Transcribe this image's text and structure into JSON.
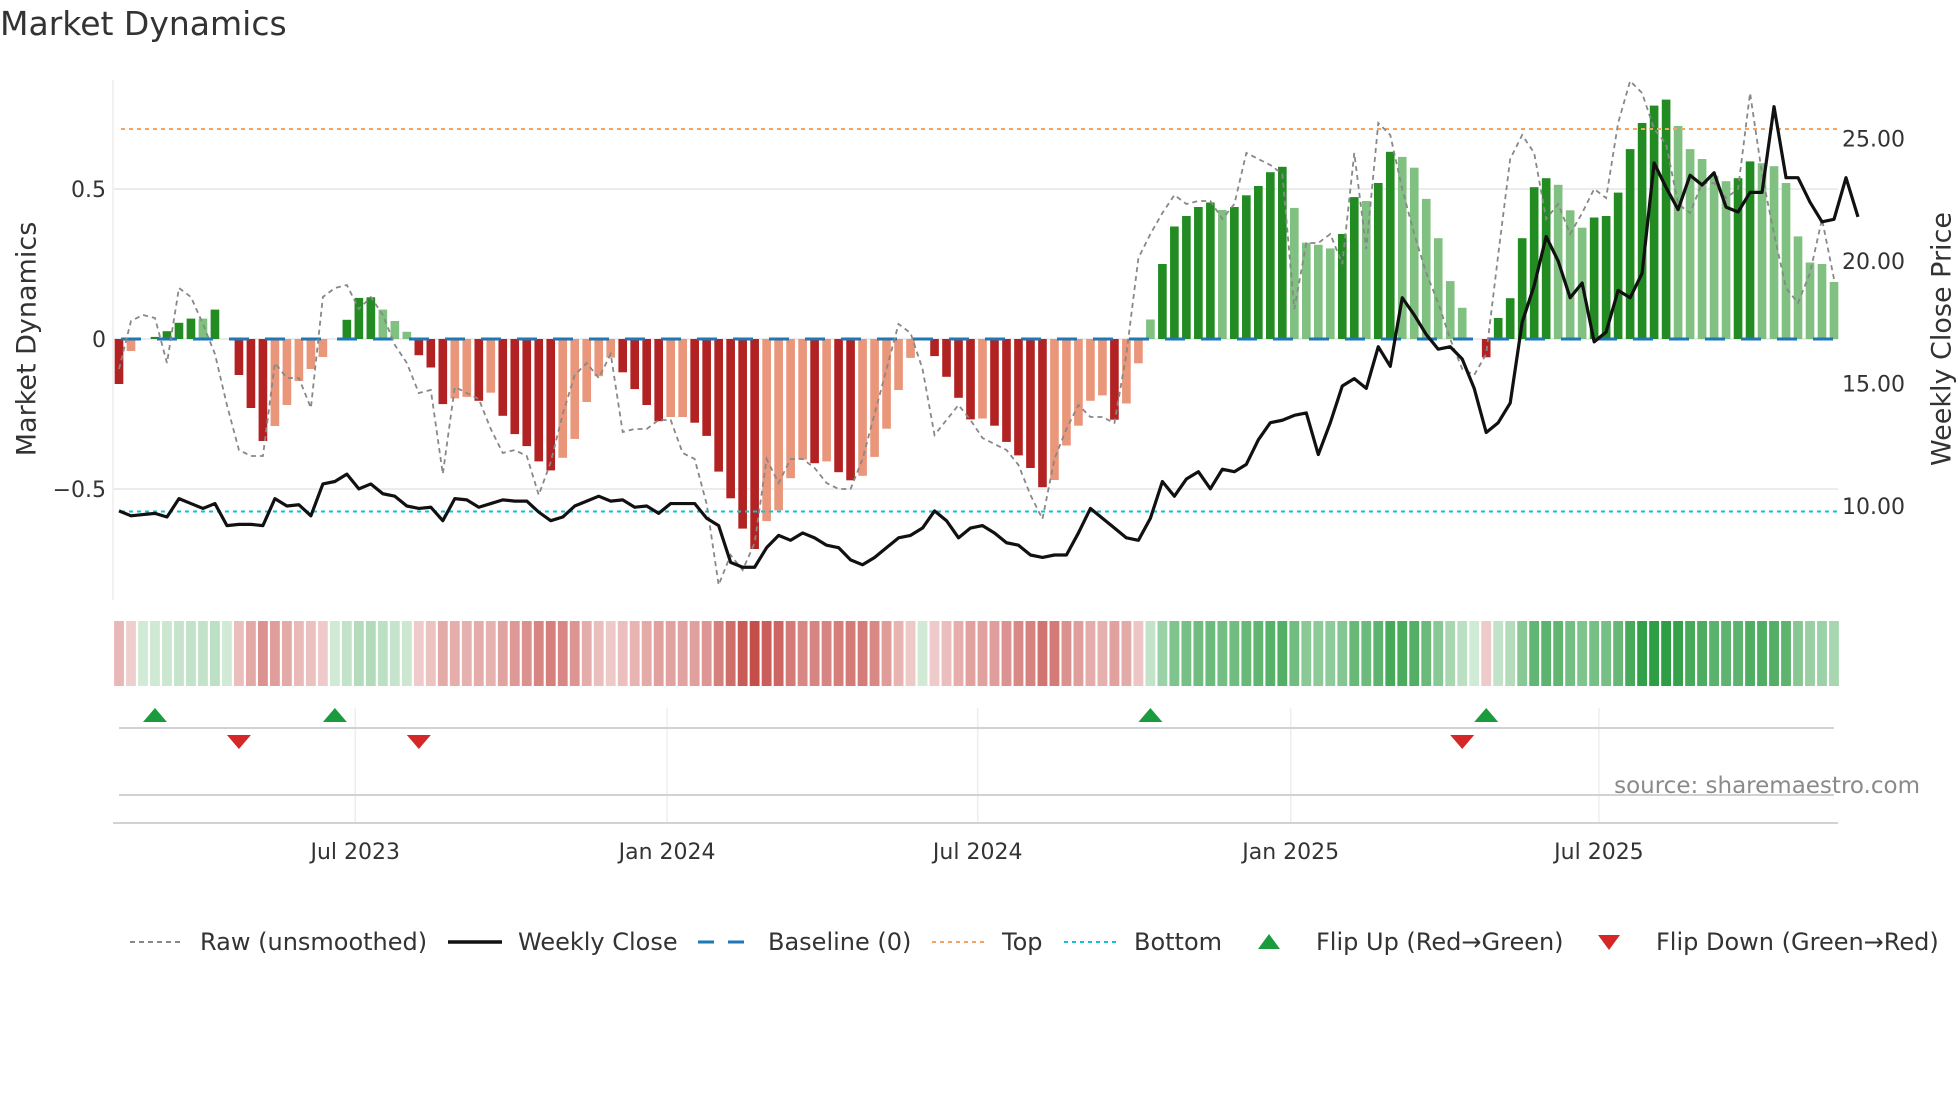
{
  "chart_data": {
    "type": "bar",
    "title": "Market Dynamics",
    "ylabel": "Market Dynamics",
    "y2label": "Weekly Close Price",
    "ylim": [
      -0.88,
      0.86
    ],
    "y2lim": [
      5.9,
      27.7
    ],
    "yticks": [
      {
        "v": 0.5,
        "label": "0.5"
      },
      {
        "v": 0,
        "label": "0"
      },
      {
        "v": -0.5,
        "label": "−0.5"
      }
    ],
    "y2ticks": [
      {
        "v": 25,
        "label": "25.00"
      },
      {
        "v": 20,
        "label": "20.00"
      },
      {
        "v": 15,
        "label": "15.00"
      },
      {
        "v": 10,
        "label": "10.00"
      }
    ],
    "xticks": [
      {
        "idx": 19.7,
        "label": "Jul 2023"
      },
      {
        "idx": 45.7,
        "label": "Jan 2024"
      },
      {
        "idx": 71.6,
        "label": "Jul 2024"
      },
      {
        "idx": 97.7,
        "label": "Jan 2025"
      },
      {
        "idx": 123.4,
        "label": "Jul 2025"
      }
    ],
    "top_level": 0.7,
    "bottom_level": -0.575,
    "baseline": 0,
    "colors": {
      "up_strong": "#228b22",
      "up_weak": "#80c080",
      "down_strong": "#b22222",
      "down_weak": "#e9967a",
      "top": "#f4a460",
      "bottom": "#17becf",
      "baseline": "#1f77b4",
      "raw": "#888888",
      "close": "#111111",
      "flip_up": "#1a9c3e",
      "flip_down": "#d62728"
    },
    "values": [
      -0.15,
      -0.04,
      0,
      0.007,
      0.026,
      0.054,
      0.068,
      0.068,
      0.098,
      0,
      -0.12,
      -0.23,
      -0.34,
      -0.29,
      -0.22,
      -0.14,
      -0.1,
      -0.06,
      0,
      0.064,
      0.137,
      0.139,
      0.098,
      0.06,
      0.024,
      -0.054,
      -0.095,
      -0.217,
      -0.198,
      -0.193,
      -0.206,
      -0.179,
      -0.256,
      -0.317,
      -0.357,
      -0.408,
      -0.438,
      -0.396,
      -0.333,
      -0.21,
      -0.124,
      -0.062,
      -0.111,
      -0.167,
      -0.22,
      -0.274,
      -0.26,
      -0.26,
      -0.279,
      -0.323,
      -0.442,
      -0.531,
      -0.632,
      -0.7,
      -0.607,
      -0.571,
      -0.464,
      -0.402,
      -0.414,
      -0.408,
      -0.444,
      -0.471,
      -0.456,
      -0.393,
      -0.299,
      -0.17,
      -0.063,
      0,
      -0.057,
      -0.126,
      -0.196,
      -0.268,
      -0.265,
      -0.289,
      -0.343,
      -0.388,
      -0.43,
      -0.494,
      -0.47,
      -0.355,
      -0.289,
      -0.206,
      -0.188,
      -0.269,
      -0.215,
      -0.081,
      0.065,
      0.25,
      0.375,
      0.41,
      0.44,
      0.455,
      0.43,
      0.44,
      0.479,
      0.51,
      0.556,
      0.574,
      0.437,
      0.321,
      0.314,
      0.302,
      0.35,
      0.473,
      0.46,
      0.52,
      0.624,
      0.607,
      0.571,
      0.467,
      0.336,
      0.193,
      0.104,
      0,
      -0.061,
      0.07,
      0.136,
      0.336,
      0.506,
      0.536,
      0.514,
      0.429,
      0.371,
      0.405,
      0.41,
      0.488,
      0.633,
      0.72,
      0.778,
      0.798,
      0.71,
      0.633,
      0.6,
      0.544,
      0.526,
      0.536,
      0.592,
      0.586,
      0.576,
      0.52,
      0.342,
      0.255,
      0.25,
      0.19
    ],
    "raw": [
      -0.1,
      0.06,
      0.08,
      0.07,
      -0.08,
      0.17,
      0.14,
      0.05,
      -0.05,
      -0.22,
      -0.37,
      -0.39,
      -0.39,
      -0.08,
      -0.13,
      -0.13,
      -0.23,
      0.14,
      0.17,
      0.18,
      0.1,
      0.14,
      0.08,
      -0.02,
      -0.08,
      -0.18,
      -0.17,
      -0.45,
      -0.16,
      -0.18,
      -0.2,
      -0.3,
      -0.38,
      -0.37,
      -0.39,
      -0.52,
      -0.41,
      -0.25,
      -0.12,
      -0.08,
      -0.13,
      -0.05,
      -0.31,
      -0.3,
      -0.3,
      -0.27,
      -0.27,
      -0.38,
      -0.4,
      -0.55,
      -0.82,
      -0.72,
      -0.77,
      -0.68,
      -0.4,
      -0.48,
      -0.4,
      -0.4,
      -0.43,
      -0.48,
      -0.5,
      -0.5,
      -0.4,
      -0.25,
      -0.1,
      0.05,
      0.02,
      -0.1,
      -0.32,
      -0.27,
      -0.22,
      -0.27,
      -0.33,
      -0.35,
      -0.37,
      -0.42,
      -0.52,
      -0.6,
      -0.4,
      -0.3,
      -0.22,
      -0.26,
      -0.26,
      -0.28,
      -0.05,
      0.27,
      0.35,
      0.42,
      0.48,
      0.45,
      0.46,
      0.46,
      0.4,
      0.45,
      0.62,
      0.6,
      0.58,
      0.55,
      0.1,
      0.32,
      0.32,
      0.35,
      0.25,
      0.62,
      0.3,
      0.72,
      0.68,
      0.5,
      0.35,
      0.22,
      0.12,
      0.0,
      -0.1,
      -0.12,
      -0.05,
      0.28,
      0.6,
      0.68,
      0.62,
      0.4,
      0.45,
      0.35,
      0.42,
      0.5,
      0.47,
      0.72,
      0.86,
      0.82,
      0.7,
      0.65,
      0.45,
      0.42,
      0.52,
      0.52,
      0.47,
      0.5,
      0.82,
      0.55,
      0.35,
      0.17,
      0.12,
      0.22,
      0.4,
      0.2
    ],
    "close": [
      9.8,
      9.6,
      9.65,
      9.7,
      9.55,
      10.3,
      10.1,
      9.9,
      10.1,
      9.2,
      9.25,
      9.25,
      9.2,
      10.3,
      10.0,
      10.05,
      9.6,
      10.9,
      11.0,
      11.3,
      10.7,
      10.9,
      10.5,
      10.4,
      10.0,
      9.9,
      9.95,
      9.4,
      10.3,
      10.25,
      9.95,
      10.1,
      10.25,
      10.2,
      10.2,
      9.75,
      9.4,
      9.55,
      10.0,
      10.2,
      10.4,
      10.2,
      10.25,
      9.95,
      10.0,
      9.7,
      10.1,
      10.1,
      10.1,
      9.5,
      9.2,
      7.7,
      7.5,
      7.5,
      8.3,
      8.8,
      8.6,
      8.9,
      8.7,
      8.4,
      8.3,
      7.8,
      7.6,
      7.9,
      8.3,
      8.7,
      8.8,
      9.1,
      9.8,
      9.4,
      8.7,
      9.1,
      9.2,
      8.9,
      8.5,
      8.4,
      8.0,
      7.9,
      8.0,
      8.0,
      8.9,
      9.9,
      9.5,
      9.1,
      8.7,
      8.6,
      9.5,
      11.0,
      10.4,
      11.1,
      11.4,
      10.7,
      11.5,
      11.4,
      11.7,
      12.7,
      13.4,
      13.5,
      13.7,
      13.8,
      12.1,
      13.4,
      14.9,
      15.2,
      14.8,
      16.5,
      15.7,
      18.5,
      17.8,
      17.0,
      16.4,
      16.5,
      16.0,
      14.8,
      13.0,
      13.4,
      14.2,
      17.5,
      19.0,
      21.0,
      20.0,
      18.5,
      19.1,
      16.7,
      17.1,
      18.8,
      18.5,
      19.5,
      24.0,
      23.0,
      22.1,
      23.5,
      23.1,
      23.6,
      22.2,
      22.0,
      22.8,
      22.8,
      26.3,
      23.4,
      23.4,
      22.4,
      21.6,
      21.7,
      23.4,
      21.8
    ],
    "flips_up": [
      3,
      18,
      86,
      114
    ],
    "flips_down": [
      10,
      25,
      112
    ],
    "source": "source: sharemaestro.com",
    "legend": {
      "placement": "bottom",
      "items": [
        "Raw (unsmoothed)",
        "Weekly Close",
        "Baseline (0)",
        "Top",
        "Bottom",
        "Flip Up (Red→Green)",
        "Flip Down (Green→Red)"
      ]
    }
  }
}
